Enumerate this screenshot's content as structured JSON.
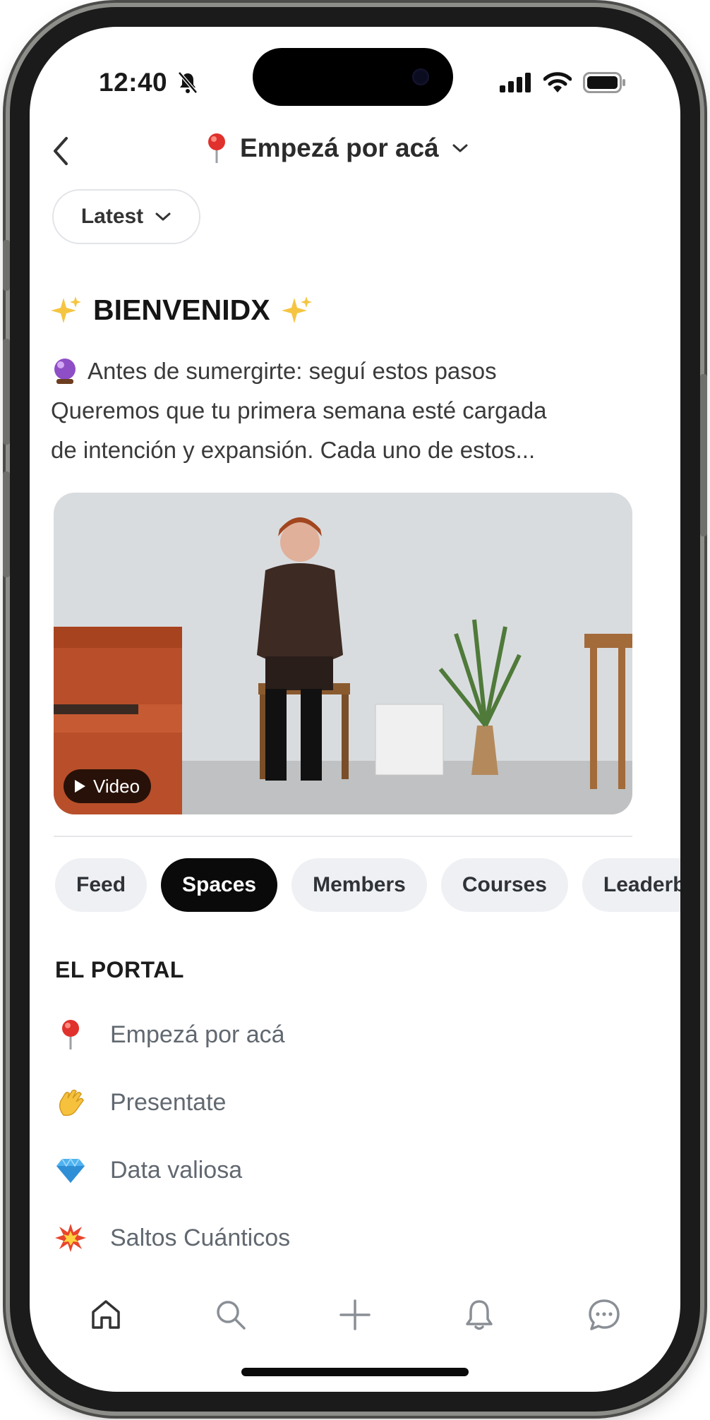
{
  "status_bar": {
    "time": "12:40"
  },
  "header": {
    "title": "Empezá por acá",
    "title_icon": "round-pushpin-icon"
  },
  "filter": {
    "label": "Latest"
  },
  "post": {
    "title": "BIENVENIDX",
    "title_icon": "sparkles-icon",
    "body_line1": "Antes de sumergirte: seguí estos pasos",
    "body_line1_icon": "crystal-ball-icon",
    "body_line2": "Queremos que tu primera semana esté cargada",
    "body_line3": "de intención y expansión. Cada uno de estos...",
    "media_badge": "Video"
  },
  "tabs": [
    {
      "label": "Feed",
      "active": false
    },
    {
      "label": "Spaces",
      "active": true
    },
    {
      "label": "Members",
      "active": false
    },
    {
      "label": "Courses",
      "active": false
    },
    {
      "label": "Leaderboard",
      "active": false
    }
  ],
  "section": {
    "title": "EL PORTAL",
    "items": [
      {
        "label": "Empezá por acá",
        "icon": "round-pushpin-icon"
      },
      {
        "label": "Presentate",
        "icon": "waving-hand-icon"
      },
      {
        "label": "Data valiosa",
        "icon": "gem-icon"
      },
      {
        "label": "Saltos Cuánticos",
        "icon": "collision-icon"
      }
    ]
  },
  "bottom_nav": [
    "home-icon",
    "search-icon",
    "plus-icon",
    "bell-icon",
    "chat-icon"
  ],
  "colors": {
    "active_tab": "#0a0a0a",
    "tab_bg": "#eef0f3",
    "muted_text": "#616870"
  }
}
